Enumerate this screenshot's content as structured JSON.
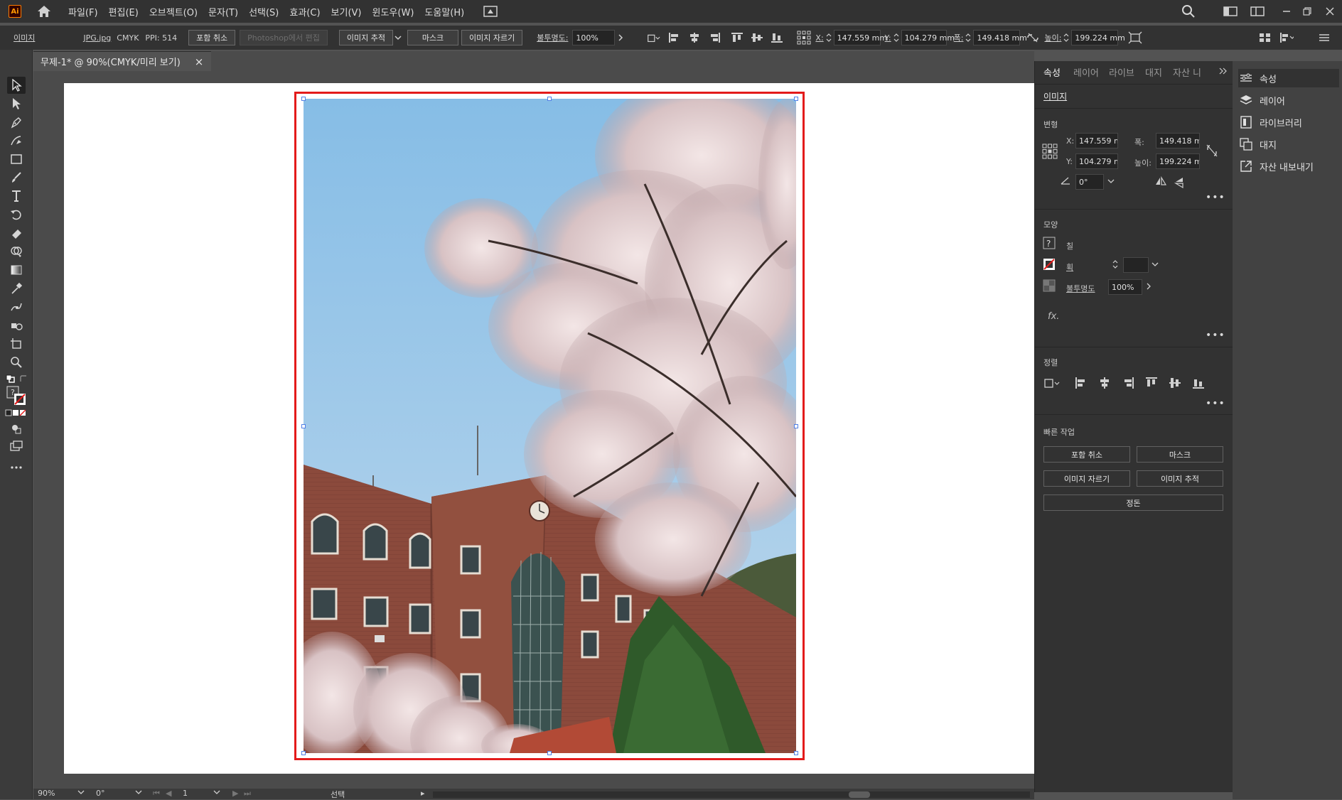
{
  "menubar": {
    "logo": "Ai",
    "items": [
      "파일(F)",
      "편집(E)",
      "오브젝트(O)",
      "문자(T)",
      "선택(S)",
      "효과(C)",
      "보기(V)",
      "윈도우(W)",
      "도움말(H)"
    ]
  },
  "controlbar": {
    "object_type": "이미지",
    "file_name": "JPG.jpg",
    "color_mode": "CMYK",
    "ppi": "PPI: 514",
    "unembed_button": "포함 취소",
    "edit_photoshop_button": "Photoshop에서 편집",
    "image_trace_button": "이미지 추적",
    "mask_button": "마스크",
    "crop_button": "이미지 자르기",
    "opacity_label": "불투명도:",
    "opacity_value": "100%",
    "x_label": "X:",
    "x_value": "147.559 mm",
    "y_label": "Y:",
    "y_value": "104.279 mm",
    "w_label": "폭:",
    "w_value": "149.418 mm",
    "h_label": "높이:",
    "h_value": "199.224 mm"
  },
  "document": {
    "tab_title": "무제-1* @ 90%(CMYK/미리 보기)",
    "close_glyph": "×"
  },
  "statusbar": {
    "zoom": "90%",
    "rotation": "0°",
    "page": "1",
    "tool_name": "선택"
  },
  "properties_panel": {
    "tabs": [
      "속성",
      "레이어",
      "라이브",
      "대지",
      "자산 니"
    ],
    "object_type": "이미지",
    "transform": {
      "title": "변형",
      "x_label": "X:",
      "x_value": "147.559 mr",
      "y_label": "Y:",
      "y_value": "104.279 mr",
      "w_label": "폭:",
      "w_value": "149.418 mr",
      "h_label": "높이:",
      "h_value": "199.224 mr",
      "angle_value": "0°"
    },
    "appearance": {
      "title": "모양",
      "fill_label": "칠",
      "stroke_label": "획",
      "opacity_label": "불투명도",
      "opacity_value": "100%",
      "fx_label": "fx."
    },
    "align": {
      "title": "정렬"
    },
    "quick_actions": {
      "title": "빠른 작업",
      "unembed": "포함 취소",
      "mask": "마스크",
      "crop": "이미지 자르기",
      "trace": "이미지 추적",
      "arrange": "정돈"
    }
  },
  "right_panel": {
    "items": [
      "속성",
      "레이어",
      "라이브러리",
      "대지",
      "자산 내보내기"
    ]
  },
  "colors": {
    "accent_selection": "#e31b1b",
    "handle_blue": "#4f7fe6",
    "ui_dark": "#323232"
  }
}
